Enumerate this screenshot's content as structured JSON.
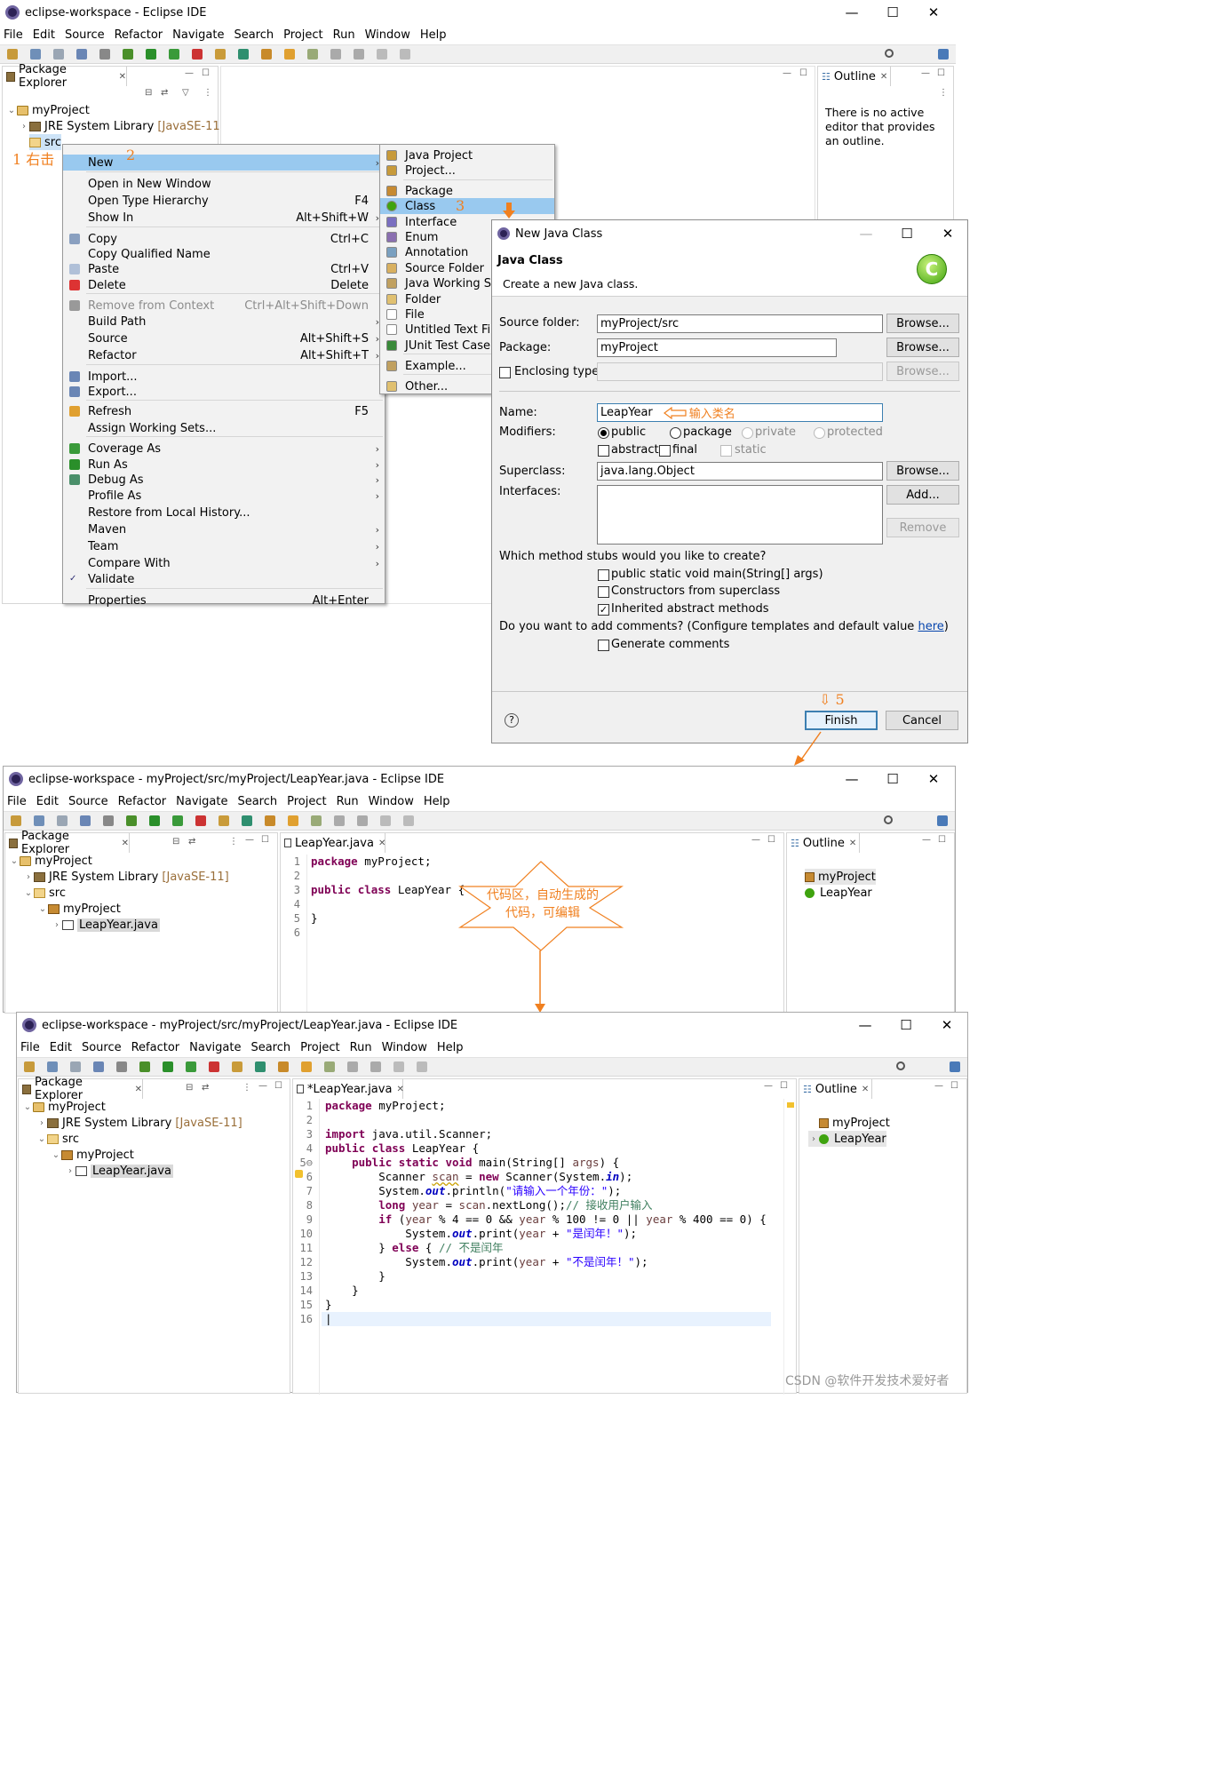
{
  "win1": {
    "title": "eclipse-workspace - Eclipse IDE",
    "menus": [
      "File",
      "Edit",
      "Source",
      "Refactor",
      "Navigate",
      "Search",
      "Project",
      "Run",
      "Window",
      "Help"
    ],
    "package_explorer": "Package Explorer",
    "outline": "Outline",
    "outline_msg": "There is no active editor that provides an outline.",
    "tree": {
      "project": "myProject",
      "jre": "JRE System Library",
      "jre_ver": "[JavaSE-11]",
      "src": "src"
    }
  },
  "annotations": {
    "step1": "1 右击",
    "step2": "2",
    "step3": "3",
    "step5": "⇩ 5",
    "name_hint": "输入类名",
    "callout": "代码区，自动生成的代码，可编辑"
  },
  "context_menu": [
    {
      "label": "New",
      "accel": "",
      "sub": true,
      "sel": true
    },
    {
      "label": "Open in New Window",
      "accel": ""
    },
    {
      "label": "Open Type Hierarchy",
      "accel": "F4"
    },
    {
      "label": "Show In",
      "accel": "Alt+Shift+W",
      "sub": true
    },
    {
      "label": "Copy",
      "accel": "Ctrl+C"
    },
    {
      "label": "Copy Qualified Name",
      "accel": ""
    },
    {
      "label": "Paste",
      "accel": "Ctrl+V"
    },
    {
      "label": "Delete",
      "accel": "Delete"
    },
    {
      "label": "Remove from Context",
      "accel": "Ctrl+Alt+Shift+Down",
      "disabled": true
    },
    {
      "label": "Build Path",
      "accel": "",
      "sub": true
    },
    {
      "label": "Source",
      "accel": "Alt+Shift+S",
      "sub": true
    },
    {
      "label": "Refactor",
      "accel": "Alt+Shift+T",
      "sub": true
    },
    {
      "label": "Import...",
      "accel": ""
    },
    {
      "label": "Export...",
      "accel": ""
    },
    {
      "label": "Refresh",
      "accel": "F5"
    },
    {
      "label": "Assign Working Sets...",
      "accel": ""
    },
    {
      "label": "Coverage As",
      "accel": "",
      "sub": true
    },
    {
      "label": "Run As",
      "accel": "",
      "sub": true
    },
    {
      "label": "Debug As",
      "accel": "",
      "sub": true
    },
    {
      "label": "Profile As",
      "accel": "",
      "sub": true
    },
    {
      "label": "Restore from Local History...",
      "accel": ""
    },
    {
      "label": "Maven",
      "accel": "",
      "sub": true
    },
    {
      "label": "Team",
      "accel": "",
      "sub": true
    },
    {
      "label": "Compare With",
      "accel": "",
      "sub": true
    },
    {
      "label": "Validate",
      "accel": ""
    },
    {
      "label": "Properties",
      "accel": "Alt+Enter"
    }
  ],
  "submenu": [
    "Java Project",
    "Project...",
    "Package",
    "Class",
    "Interface",
    "Enum",
    "Annotation",
    "Source Folder",
    "Java Working Set",
    "Folder",
    "File",
    "Untitled Text File",
    "JUnit Test Case",
    "Example...",
    "Other..."
  ],
  "dialog": {
    "title": "New Java Class",
    "heading": "Java Class",
    "subheading": "Create a new Java class.",
    "source_folder_label": "Source folder:",
    "source_folder": "myProject/src",
    "package_label": "Package:",
    "package": "myProject",
    "enclosing_label": "Enclosing type:",
    "name_label": "Name:",
    "name": "LeapYear",
    "modifiers_label": "Modifiers:",
    "mod_public": "public",
    "mod_package": "package",
    "mod_private": "private",
    "mod_protected": "protected",
    "mod_abstract": "abstract",
    "mod_final": "final",
    "mod_static": "static",
    "superclass_label": "Superclass:",
    "superclass": "java.lang.Object",
    "interfaces_label": "Interfaces:",
    "browse": "Browse...",
    "add": "Add...",
    "remove": "Remove",
    "stubs_q": "Which method stubs would you like to create?",
    "stub_main": "public static void main(String[] args)",
    "stub_ctor": "Constructors from superclass",
    "stub_inherit": "Inherited abstract methods",
    "comments_q": "Do you want to add comments? (Configure templates and default value ",
    "comments_link": "here",
    "comments_end": ")",
    "gen_comments": "Generate comments",
    "help": "?",
    "finish": "Finish",
    "cancel": "Cancel"
  },
  "win2": {
    "title": "eclipse-workspace - myProject/src/myProject/LeapYear.java - Eclipse IDE",
    "editor_tab": "LeapYear.java",
    "tree": {
      "project": "myProject",
      "jre": "JRE System Library",
      "jre_ver": "[JavaSE-11]",
      "src": "src",
      "pkg": "myProject",
      "file": "LeapYear.java"
    },
    "outline_items": [
      "myProject",
      "LeapYear"
    ],
    "line_numbers": [
      "1",
      "2",
      "3",
      "4",
      "5",
      "6"
    ]
  },
  "win3": {
    "title": "eclipse-workspace - myProject/src/myProject/LeapYear.java - Eclipse IDE",
    "editor_tab": "*LeapYear.java",
    "outline_items": [
      "myProject",
      "LeapYear"
    ],
    "line_numbers": [
      "1",
      "2",
      "3",
      "4",
      "5⊖",
      "6",
      "7",
      "8",
      "9",
      "10",
      "11",
      "12",
      "13",
      "14",
      "15",
      "16"
    ]
  },
  "watermark": "CSDN @软件开发技术爱好者"
}
